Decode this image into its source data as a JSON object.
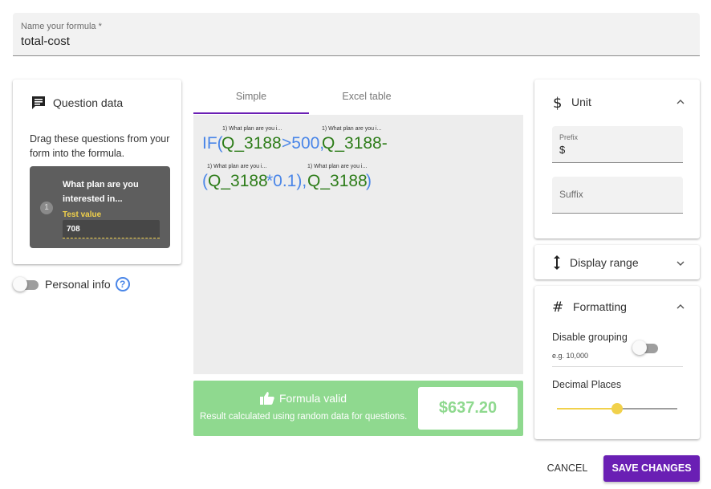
{
  "name_field": {
    "label": "Name your formula *",
    "value": "total-cost"
  },
  "question_data": {
    "title": "Question data",
    "description": "Drag these questions from your form into the formula.",
    "question": {
      "number": "1",
      "title": "What plan are you interested in...",
      "test_value_label": "Test value",
      "test_value": "708"
    }
  },
  "personal_info": {
    "label": "Personal info",
    "enabled": false,
    "help": "?"
  },
  "tabs": [
    {
      "label": "Simple",
      "active": true
    },
    {
      "label": "Excel table",
      "active": false
    }
  ],
  "formula": {
    "caption": "1) What plan are you i...",
    "tokens": {
      "if_open": "IF(",
      "q1": "Q_3188",
      "cmp": ">500,",
      "q2": "Q_3188-",
      "paren_open": "(",
      "q3": "Q_3188",
      "mul": "*0.1),",
      "q4": "Q_3188",
      "close": ")"
    }
  },
  "result": {
    "status": "Formula valid",
    "note": "Result calculated using random data for questions.",
    "value": "$637.20",
    "color": "#8fd98f"
  },
  "unit": {
    "title": "Unit",
    "prefix_label": "Prefix",
    "prefix_value": "$",
    "suffix_placeholder": "Suffix"
  },
  "display_range": {
    "title": "Display range"
  },
  "formatting": {
    "title": "Formatting",
    "disable_grouping_label": "Disable grouping",
    "grouping_example": "e.g. 10,000",
    "disable_grouping": false,
    "decimal_places_label": "Decimal Places",
    "decimal_places_fraction": 0.5
  },
  "actions": {
    "cancel": "CANCEL",
    "save": "SAVE CHANGES"
  },
  "colors": {
    "accent": "#6a1fb4",
    "highlight": "#f1d14b",
    "token_blue": "#4a86e8",
    "token_green": "#2e7d1a"
  }
}
